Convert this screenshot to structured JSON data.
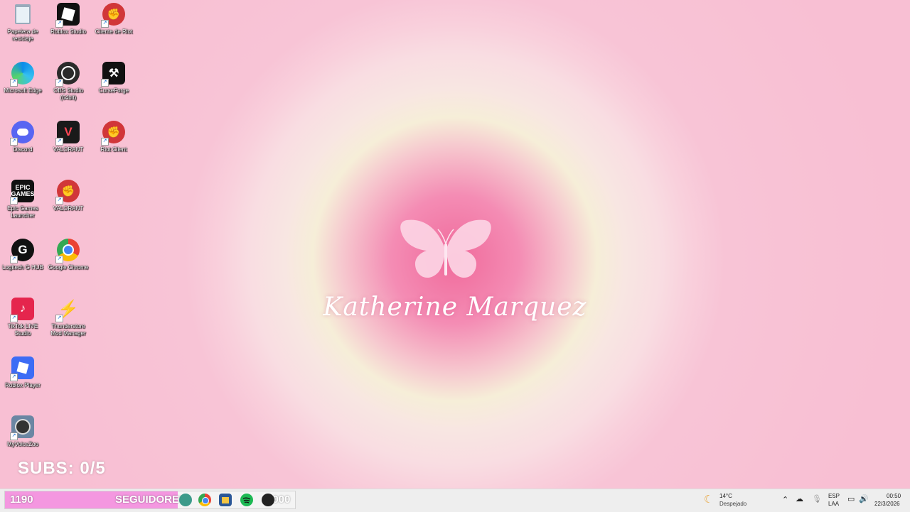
{
  "desktop_icons": [
    {
      "label": "Papelera de reciclaje",
      "icon": "recycle-bin-icon"
    },
    {
      "label": "Roblox Studio",
      "icon": "roblox-studio-icon"
    },
    {
      "label": "Cliente de Riot",
      "icon": "riot-client-icon"
    },
    {
      "label": "Microsoft Edge",
      "icon": "edge-icon"
    },
    {
      "label": "OBS Studio (64bit)",
      "icon": "obs-icon"
    },
    {
      "label": "CurseForge",
      "icon": "curseforge-icon"
    },
    {
      "label": "Discord",
      "icon": "discord-icon"
    },
    {
      "label": "VALORANT",
      "icon": "valorant-icon"
    },
    {
      "label": "Riot Client",
      "icon": "riot-client-icon"
    },
    {
      "label": "Epic Games Launcher",
      "icon": "epic-games-icon"
    },
    {
      "label": "VALORANT",
      "icon": "riot-client-icon"
    },
    {
      "label": "Logitech G HUB",
      "icon": "logitech-icon"
    },
    {
      "label": "Google Chrome",
      "icon": "chrome-icon"
    },
    {
      "label": "TikTok LIVE Studio",
      "icon": "tiktok-icon"
    },
    {
      "label": "Thunderstore Mod Manager",
      "icon": "thunderstore-icon"
    },
    {
      "label": "Roblox Player",
      "icon": "roblox-player-icon"
    },
    {
      "label": "MyVoiceZoo",
      "icon": "myvoicezoo-icon"
    }
  ],
  "wallpaper": {
    "name": "Katherine Marquez"
  },
  "overlay": {
    "subs_text": "SUBS: 0/5",
    "followers_count": "1190",
    "followers_label": "SEGUIDORES",
    "followers_goal": "2000",
    "progress": 0.595
  },
  "taskbar": {
    "apps": [
      "file-explorer-icon",
      "chrome-icon",
      "store-icon",
      "spotify-icon",
      "github-icon"
    ],
    "weather_temp": "14°C",
    "weather_desc": "Despejado",
    "language_top": "ESP",
    "language_bottom": "LAA",
    "time": "00:50",
    "date": "22/3/2026"
  },
  "colors": {
    "bar_fill": "#f497e0",
    "riot_red": "#d13639",
    "discord": "#5865f2"
  }
}
